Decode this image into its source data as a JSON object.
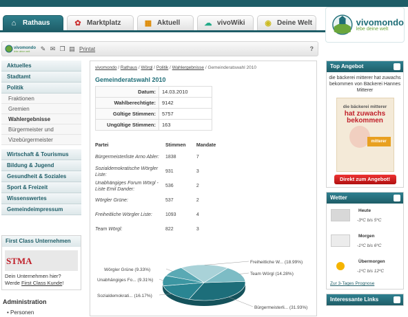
{
  "tabs": [
    {
      "label": "Rathaus",
      "icon": "townhall-icon"
    },
    {
      "label": "Marktplatz",
      "icon": "market-icon"
    },
    {
      "label": "Aktuell",
      "icon": "news-icon"
    },
    {
      "label": "vivoWiki",
      "icon": "wiki-icon"
    },
    {
      "label": "Deine Welt",
      "icon": "world-icon"
    }
  ],
  "logo": {
    "name": "vivomondo",
    "tagline": "lebe deine welt"
  },
  "toolbar": {
    "print_label": "Printat",
    "help": "?"
  },
  "sidebar": {
    "items": [
      {
        "label": "Aktuelles",
        "type": "main"
      },
      {
        "label": "Stadtamt",
        "type": "main"
      },
      {
        "label": "Politik",
        "type": "main"
      },
      {
        "label": "Fraktionen",
        "type": "sub"
      },
      {
        "label": "Gremien",
        "type": "sub"
      },
      {
        "label": "Wahlergebnisse",
        "type": "sub-bold"
      },
      {
        "label": "Bürgermeister und",
        "type": "sub"
      },
      {
        "label": "Vizebürgermeister",
        "type": "sub"
      },
      {
        "label": "Wirtschaft & Tourismus",
        "type": "main"
      },
      {
        "label": "Bildung & Jugend",
        "type": "main"
      },
      {
        "label": "Gesundheit & Soziales",
        "type": "main"
      },
      {
        "label": "Sport & Freizeit",
        "type": "main"
      },
      {
        "label": "Wissenswertes",
        "type": "main"
      },
      {
        "label": "Gemeindeimpressum",
        "type": "main"
      }
    ]
  },
  "firstclass": {
    "title": "First Class Unternehmen",
    "logo_text": "STMA",
    "text1": "Dein Unternehmen hier?",
    "text2": "Werde ",
    "link": "First Class Kunde",
    "text3": "!"
  },
  "admin": {
    "title": "Administration",
    "item": "Personen"
  },
  "breadcrumb": {
    "items": [
      "vivomondo",
      "Rathaus",
      "Wörgl",
      "Politik",
      "Wahlergebnisse"
    ],
    "current": "Gemeinderatswahl 2010",
    "sep": " / "
  },
  "main": {
    "title": "Gemeinderatswahl 2010",
    "info": [
      {
        "key": "Datum:",
        "value": "14.03.2010"
      },
      {
        "key": "Wahlberechtigte:",
        "value": "9142"
      },
      {
        "key": "Gültige Stimmen:",
        "value": "5757"
      },
      {
        "key": "Ungültige Stimmen:",
        "value": "163"
      }
    ],
    "results_headers": [
      "Partei",
      "Stimmen",
      "Mandate"
    ],
    "results": [
      {
        "party": "Bürgermeisterliste Arno Abler:",
        "votes": "1838",
        "seats": "7"
      },
      {
        "party": "Sozialdemokratische Wörgler Liste:",
        "votes": "931",
        "seats": "3"
      },
      {
        "party": "Unabhängiges Forum Wörgl - Liste Emil Dander:",
        "votes": "536",
        "seats": "2"
      },
      {
        "party": "Wörgler Grüne:",
        "votes": "537",
        "seats": "2"
      },
      {
        "party": "Freiheitliche Wörgler Liste:",
        "votes": "1093",
        "seats": "4"
      },
      {
        "party": "Team Wörgl:",
        "votes": "822",
        "seats": "3"
      }
    ]
  },
  "chart_data": {
    "type": "pie",
    "slices": [
      {
        "label": "Bürgermeisterli... (31.93%)",
        "value": 31.93,
        "color": "#1d6e7a"
      },
      {
        "label": "Sozialdemokrati... (16.17%)",
        "value": 16.17,
        "color": "#2a8592"
      },
      {
        "label": "Unabhängiges Fo... (9.31%)",
        "value": 9.31,
        "color": "#3c96a2"
      },
      {
        "label": "Wörgler Grüne (9.33%)",
        "value": 9.33,
        "color": "#5aa9b4"
      },
      {
        "label": "Freiheitliche W... (18.99%)",
        "value": 18.99,
        "color": "#a9d2d8"
      },
      {
        "label": "Team Wörgl (14.28%)",
        "value": 14.28,
        "color": "#7dbcc5"
      }
    ]
  },
  "ad": {
    "title": "Top Angebot",
    "text": "die bäckerei mitterer hat zuwachs bekommen von Bäckerei Hannes Mitterer",
    "img_line1": "die bäckerei mitterer",
    "img_line2": "hat zuwachs",
    "img_line3": "bekommen",
    "brand": "mitterer",
    "button": "Direkt zum Angebot!"
  },
  "weather": {
    "title": "Wetter",
    "days": [
      {
        "day": "Heute",
        "temp": "-3ºC bis 5ºC",
        "icon": "cloudy-icon"
      },
      {
        "day": "Morgen",
        "temp": "-1ºC bis 6ºC",
        "icon": "cloudy-icon"
      },
      {
        "day": "Übermorgen",
        "temp": "-1ºC bis 12ºC",
        "icon": "sunny-icon"
      }
    ],
    "link": "Zur 3-Tages Prognose"
  },
  "links": {
    "title": "Interessante Links"
  }
}
